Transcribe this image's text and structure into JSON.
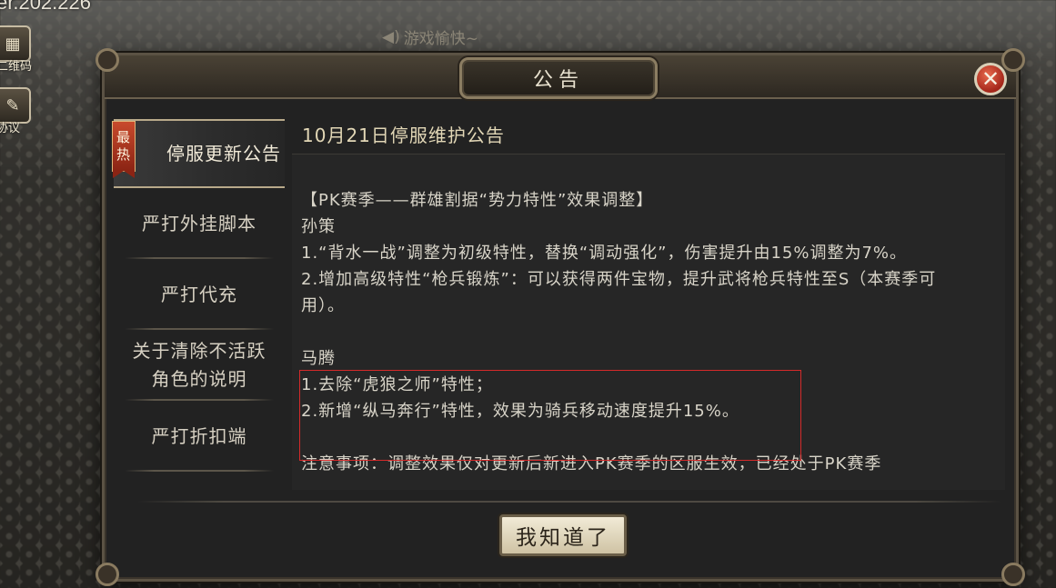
{
  "version_text": "er.202.226",
  "side_buttons": [
    {
      "label": "二维码",
      "icon": "qr-code-icon"
    },
    {
      "label": "协议",
      "icon": "pen-icon"
    }
  ],
  "marquee": {
    "icon": "speaker-icon",
    "text": "游戏愉快~"
  },
  "dialog": {
    "title": "公告",
    "close_icon": "close-icon",
    "ok_label": "我知道了"
  },
  "tabs": [
    {
      "label": "停服更新公告",
      "badge": [
        "最",
        "热"
      ],
      "active": true
    },
    {
      "label": "严打外挂脚本",
      "active": false
    },
    {
      "label": "严打代充",
      "active": false
    },
    {
      "label": "关于清除不活跃角色的说明",
      "active": false
    },
    {
      "label": "严打折扣端",
      "active": false
    }
  ],
  "content": {
    "title": "10月21日停服维护公告",
    "paragraphs": [
      {
        "lines": [
          "【PK赛季——群雄割据“势力特性”效果调整】",
          "孙策",
          "1.“背水一战”调整为初级特性，替换“调动强化”，伤害提升由15%调整为7%。",
          "2.增加高级特性“枪兵锻炼”：可以获得两件宝物，提升武将枪兵特性至S（本赛季可用）。"
        ]
      },
      {
        "lines": [
          "马腾",
          "1.去除“虎狼之师”特性；",
          "2.新增“纵马奔行”特性，效果为骑兵移动速度提升15%。"
        ]
      },
      {
        "lines": [
          "注意事项：调整效果仅对更新后新进入PK赛季的区服生效，已经处于PK赛季"
        ]
      }
    ]
  },
  "colors": {
    "highlight_border": "#d52a2a",
    "hot_badge": "#c84a2c",
    "title_text": "#e2d7b6"
  }
}
